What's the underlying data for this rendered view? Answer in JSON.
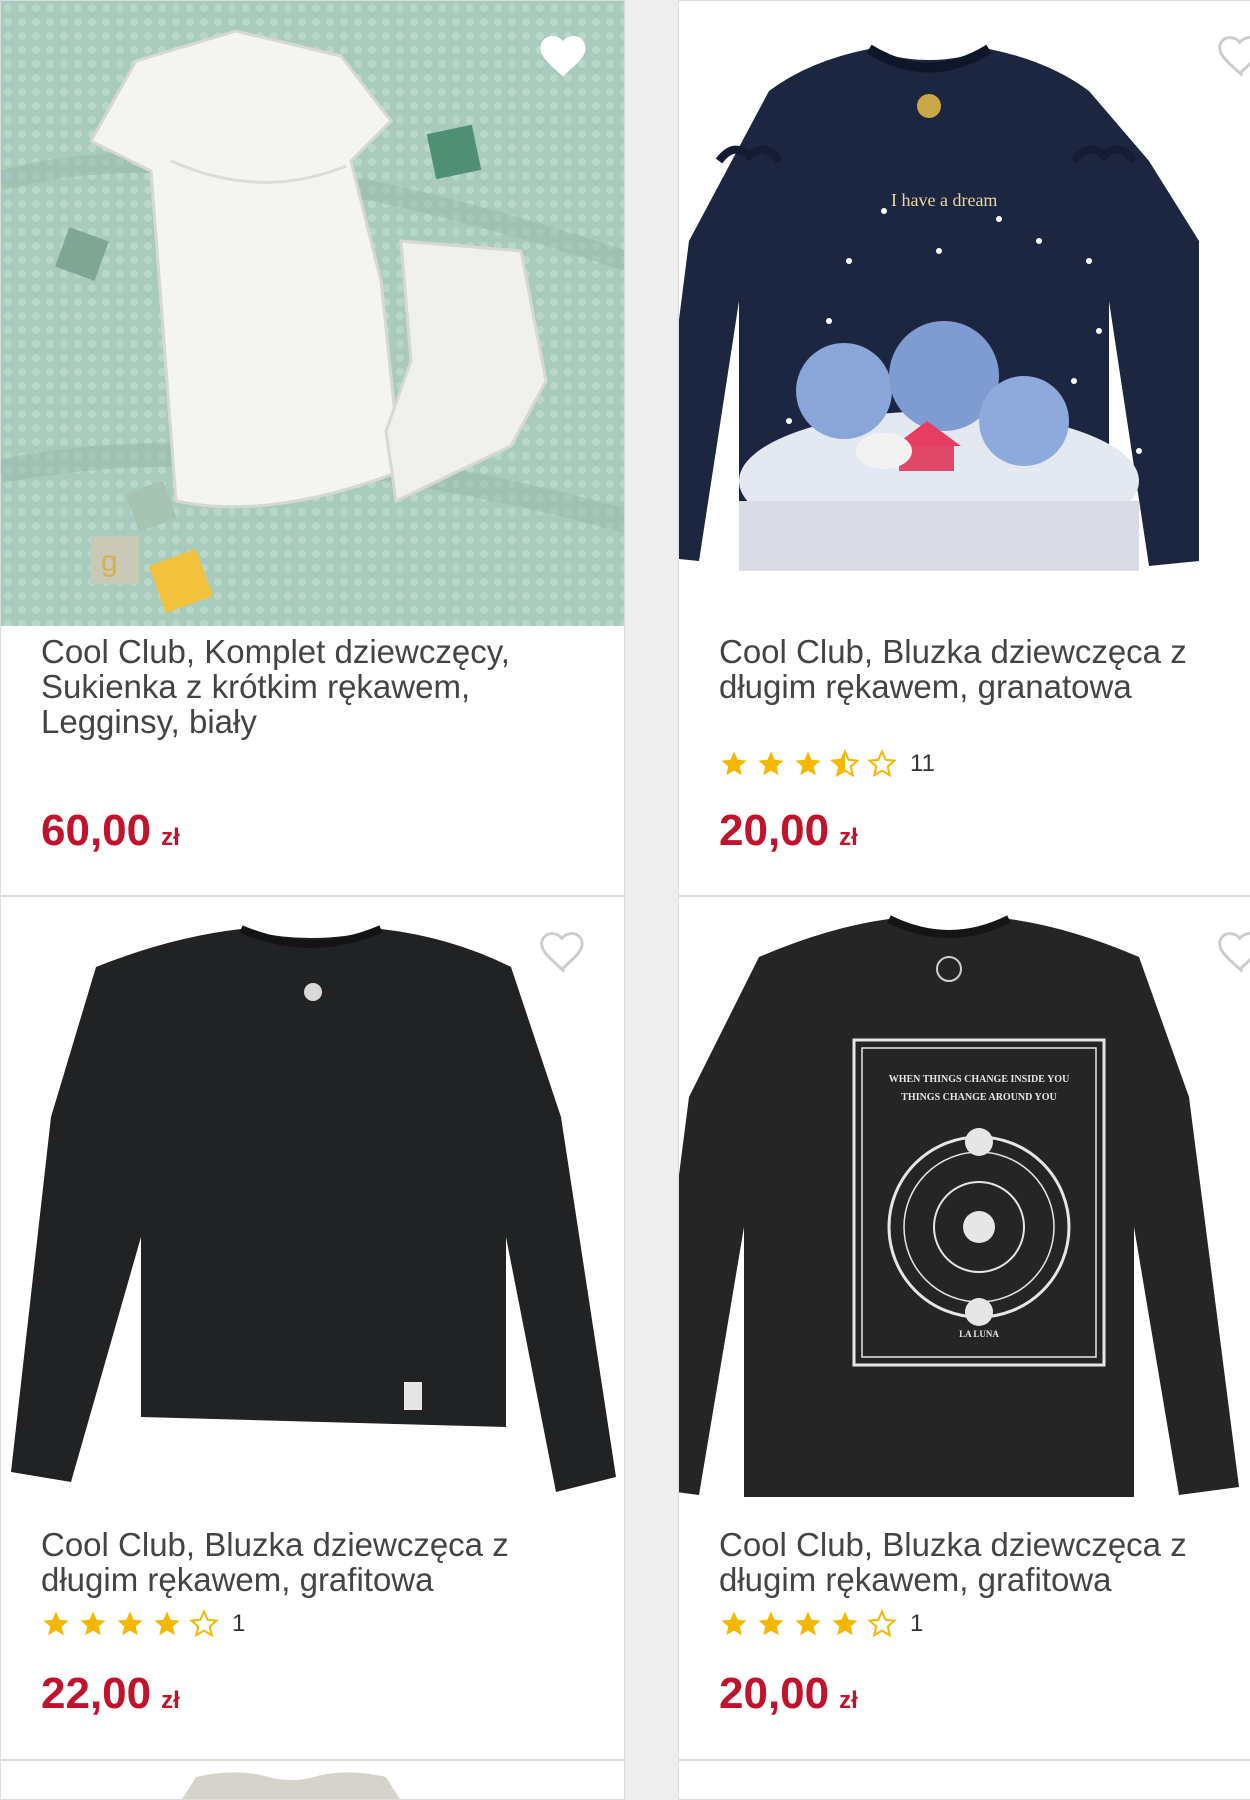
{
  "colors": {
    "price": "#c0132c",
    "star": "#f5b800",
    "star_empty": "#f5b800"
  },
  "products": [
    {
      "title": "Cool Club, Komplet dziewczęcy, Sukienka z krótkim rękawem, Legginsy, biały",
      "price": "60,00",
      "currency": "zł",
      "favorite_icon": "heart-icon-filled"
    },
    {
      "title": "Cool Club, Bluzka dziewczęca z długim rękawem, granatowa",
      "rating": 3.5,
      "rating_count": "11",
      "price": "20,00",
      "currency": "zł",
      "favorite_icon": "heart-icon-outline",
      "print_text": "I have a dream"
    },
    {
      "title": "Cool Club, Bluzka dziewczęca z długim rękawem, grafitowa",
      "rating": 4,
      "rating_count": "1",
      "price": "22,00",
      "currency": "zł",
      "favorite_icon": "heart-icon-outline"
    },
    {
      "title": "Cool Club, Bluzka dziewczęca z długim rękawem, grafitowa",
      "rating": 4,
      "rating_count": "1",
      "price": "20,00",
      "currency": "zł",
      "favorite_icon": "heart-icon-outline",
      "print_text_1": "WHEN THINGS CHANGE INSIDE YOU",
      "print_text_2": "THINGS CHANGE AROUND YOU",
      "print_text_3": "LA LUNA"
    }
  ]
}
